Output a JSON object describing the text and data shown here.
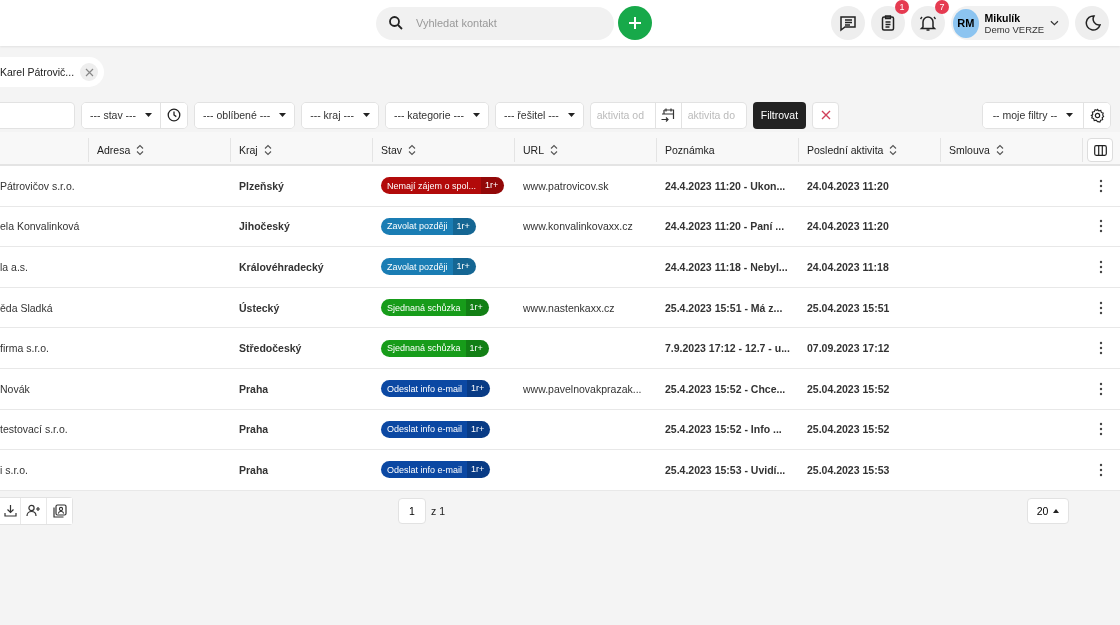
{
  "search": {
    "placeholder": "Vyhledat kontakt"
  },
  "header_icons": [
    {
      "kind": "chat"
    },
    {
      "kind": "clipboard",
      "badge": "1"
    },
    {
      "kind": "bell",
      "badge": "7"
    }
  ],
  "user": {
    "initials": "RM",
    "name": "Mikulík",
    "subtitle": "Demo VERZE"
  },
  "open_tabs": [
    {
      "label": "Karel Pátrovič..."
    }
  ],
  "filters": [
    {
      "kind": "input"
    },
    {
      "kind": "select",
      "label": "--- stav ---",
      "history": true
    },
    {
      "kind": "select",
      "label": "--- oblíbené ---"
    },
    {
      "kind": "select",
      "label": "--- kraj ---"
    },
    {
      "kind": "select",
      "label": "--- kategorie ---"
    },
    {
      "kind": "select",
      "label": "--- řešitel ---"
    },
    {
      "kind": "daterange",
      "from": {
        "placeholder": "aktivita od"
      },
      "to": {
        "placeholder": "aktivita do"
      }
    },
    {
      "kind": "submit",
      "label": "Filtrovat"
    },
    {
      "kind": "clear"
    }
  ],
  "saved_filters": {
    "label": "-- moje filtry --"
  },
  "table": {
    "columns": [
      {
        "label": "Adresa",
        "sortable": true
      },
      {
        "label": "Kraj",
        "sortable": true
      },
      {
        "label": "Stav",
        "sortable": true
      },
      {
        "label": "URL",
        "sortable": true
      },
      {
        "label": "Poznámka",
        "sortable": false
      },
      {
        "label": "Poslední aktivita",
        "sortable": true
      },
      {
        "label": "Smlouva",
        "sortable": true
      }
    ],
    "rows": [
      {
        "name": "Pátrovičov s.r.o.",
        "region": "Plzeňský",
        "status": {
          "label": "Nemají zájem o spol...",
          "count": "1r+",
          "color": "#b20a0a"
        },
        "url": "www.patrovicov.sk",
        "note": "24.4.2023 11:20 - Ukon...",
        "last_activity": "24.04.2023 11:20"
      },
      {
        "name": "ela Konvalinková",
        "region": "Jihočeský",
        "status": {
          "label": "Zavolat později",
          "count": "1r+",
          "color": "#1a7db4"
        },
        "url": "www.konvalinkovaxx.cz",
        "note": "24.4.2023 11:20 - Paní ...",
        "last_activity": "24.04.2023 11:20"
      },
      {
        "name": "la a.s.",
        "region": "Královéhradecký",
        "status": {
          "label": "Zavolat později",
          "count": "1r+",
          "color": "#1a7db4"
        },
        "note": "24.4.2023 11:18 - Nebyl...",
        "last_activity": "24.04.2023 11:18"
      },
      {
        "name": "ěda Sladká",
        "region": "Ústecký",
        "status": {
          "label": "Sjednaná schůzka",
          "count": "1r+",
          "color": "#179c1a"
        },
        "url": "www.nastenkaxx.cz",
        "note": "25.4.2023 15:51 - Má z...",
        "last_activity": "25.04.2023 15:51"
      },
      {
        "name": "firma s.r.o.",
        "region": "Středočeský",
        "status": {
          "label": "Sjednaná schůzka",
          "count": "1r+",
          "color": "#179c1a"
        },
        "note": "7.9.2023 17:12 - 12.7 - u...",
        "last_activity": "07.09.2023 17:12"
      },
      {
        "name": "Novák",
        "region": "Praha",
        "status": {
          "label": "Odeslat info e-mail",
          "count": "1r+",
          "color": "#0b48a3"
        },
        "url": "www.pavelnovakprazak...",
        "note": "25.4.2023 15:52 - Chce...",
        "last_activity": "25.04.2023 15:52"
      },
      {
        "name": "testovací s.r.o.",
        "region": "Praha",
        "status": {
          "label": "Odeslat info e-mail",
          "count": "1r+",
          "color": "#0b48a3"
        },
        "note": "25.4.2023 15:52 - Info ...",
        "last_activity": "25.04.2023 15:52"
      },
      {
        "name": "i s.r.o.",
        "region": "Praha",
        "status": {
          "label": "Odeslat info e-mail",
          "count": "1r+",
          "color": "#0b48a3"
        },
        "note": "25.4.2023 15:53 - Uvidí...",
        "last_activity": "25.04.2023 15:53"
      }
    ]
  },
  "pagination": {
    "page": "1",
    "of": "z 1",
    "page_size": "20"
  }
}
